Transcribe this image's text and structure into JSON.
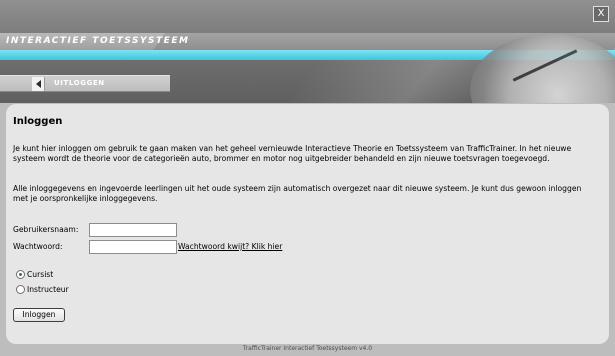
{
  "header": {
    "app_title": "INTERACTIEF TOETSSYSTEEM",
    "close_label": "X",
    "logout_label": "UITLOGGEN"
  },
  "login": {
    "heading": "Inloggen",
    "paragraph1": "Je kunt hier inloggen om gebruik te gaan maken van het geheel vernieuwde Interactieve Theorie en Toetssysteem van TrafficTrainer. In het nieuwe systeem wordt de theorie voor de categorieën auto, brommer en motor nog uitgebreider behandeld en zijn nieuwe toetsvragen toegevoegd.",
    "paragraph2": "Alle inloggegevens en ingevoerde leerlingen uit het oude systeem zijn automatisch overgezet naar dit nieuwe systeem. Je kunt dus gewoon inloggen met je oorspronkelijke inloggegevens.",
    "username_label": "Gebruikersnaam:",
    "username_value": "",
    "password_label": "Wachtwoord:",
    "password_value": "",
    "forgot_link": "Wachtwoord kwijt? Klik hier",
    "roles": [
      {
        "label": "Cursist",
        "selected": true
      },
      {
        "label": "Instructeur",
        "selected": false
      }
    ],
    "submit_label": "Inloggen"
  },
  "footer": {
    "text": "TrafficTrainer Interactief Toetssysteem v4.0"
  }
}
